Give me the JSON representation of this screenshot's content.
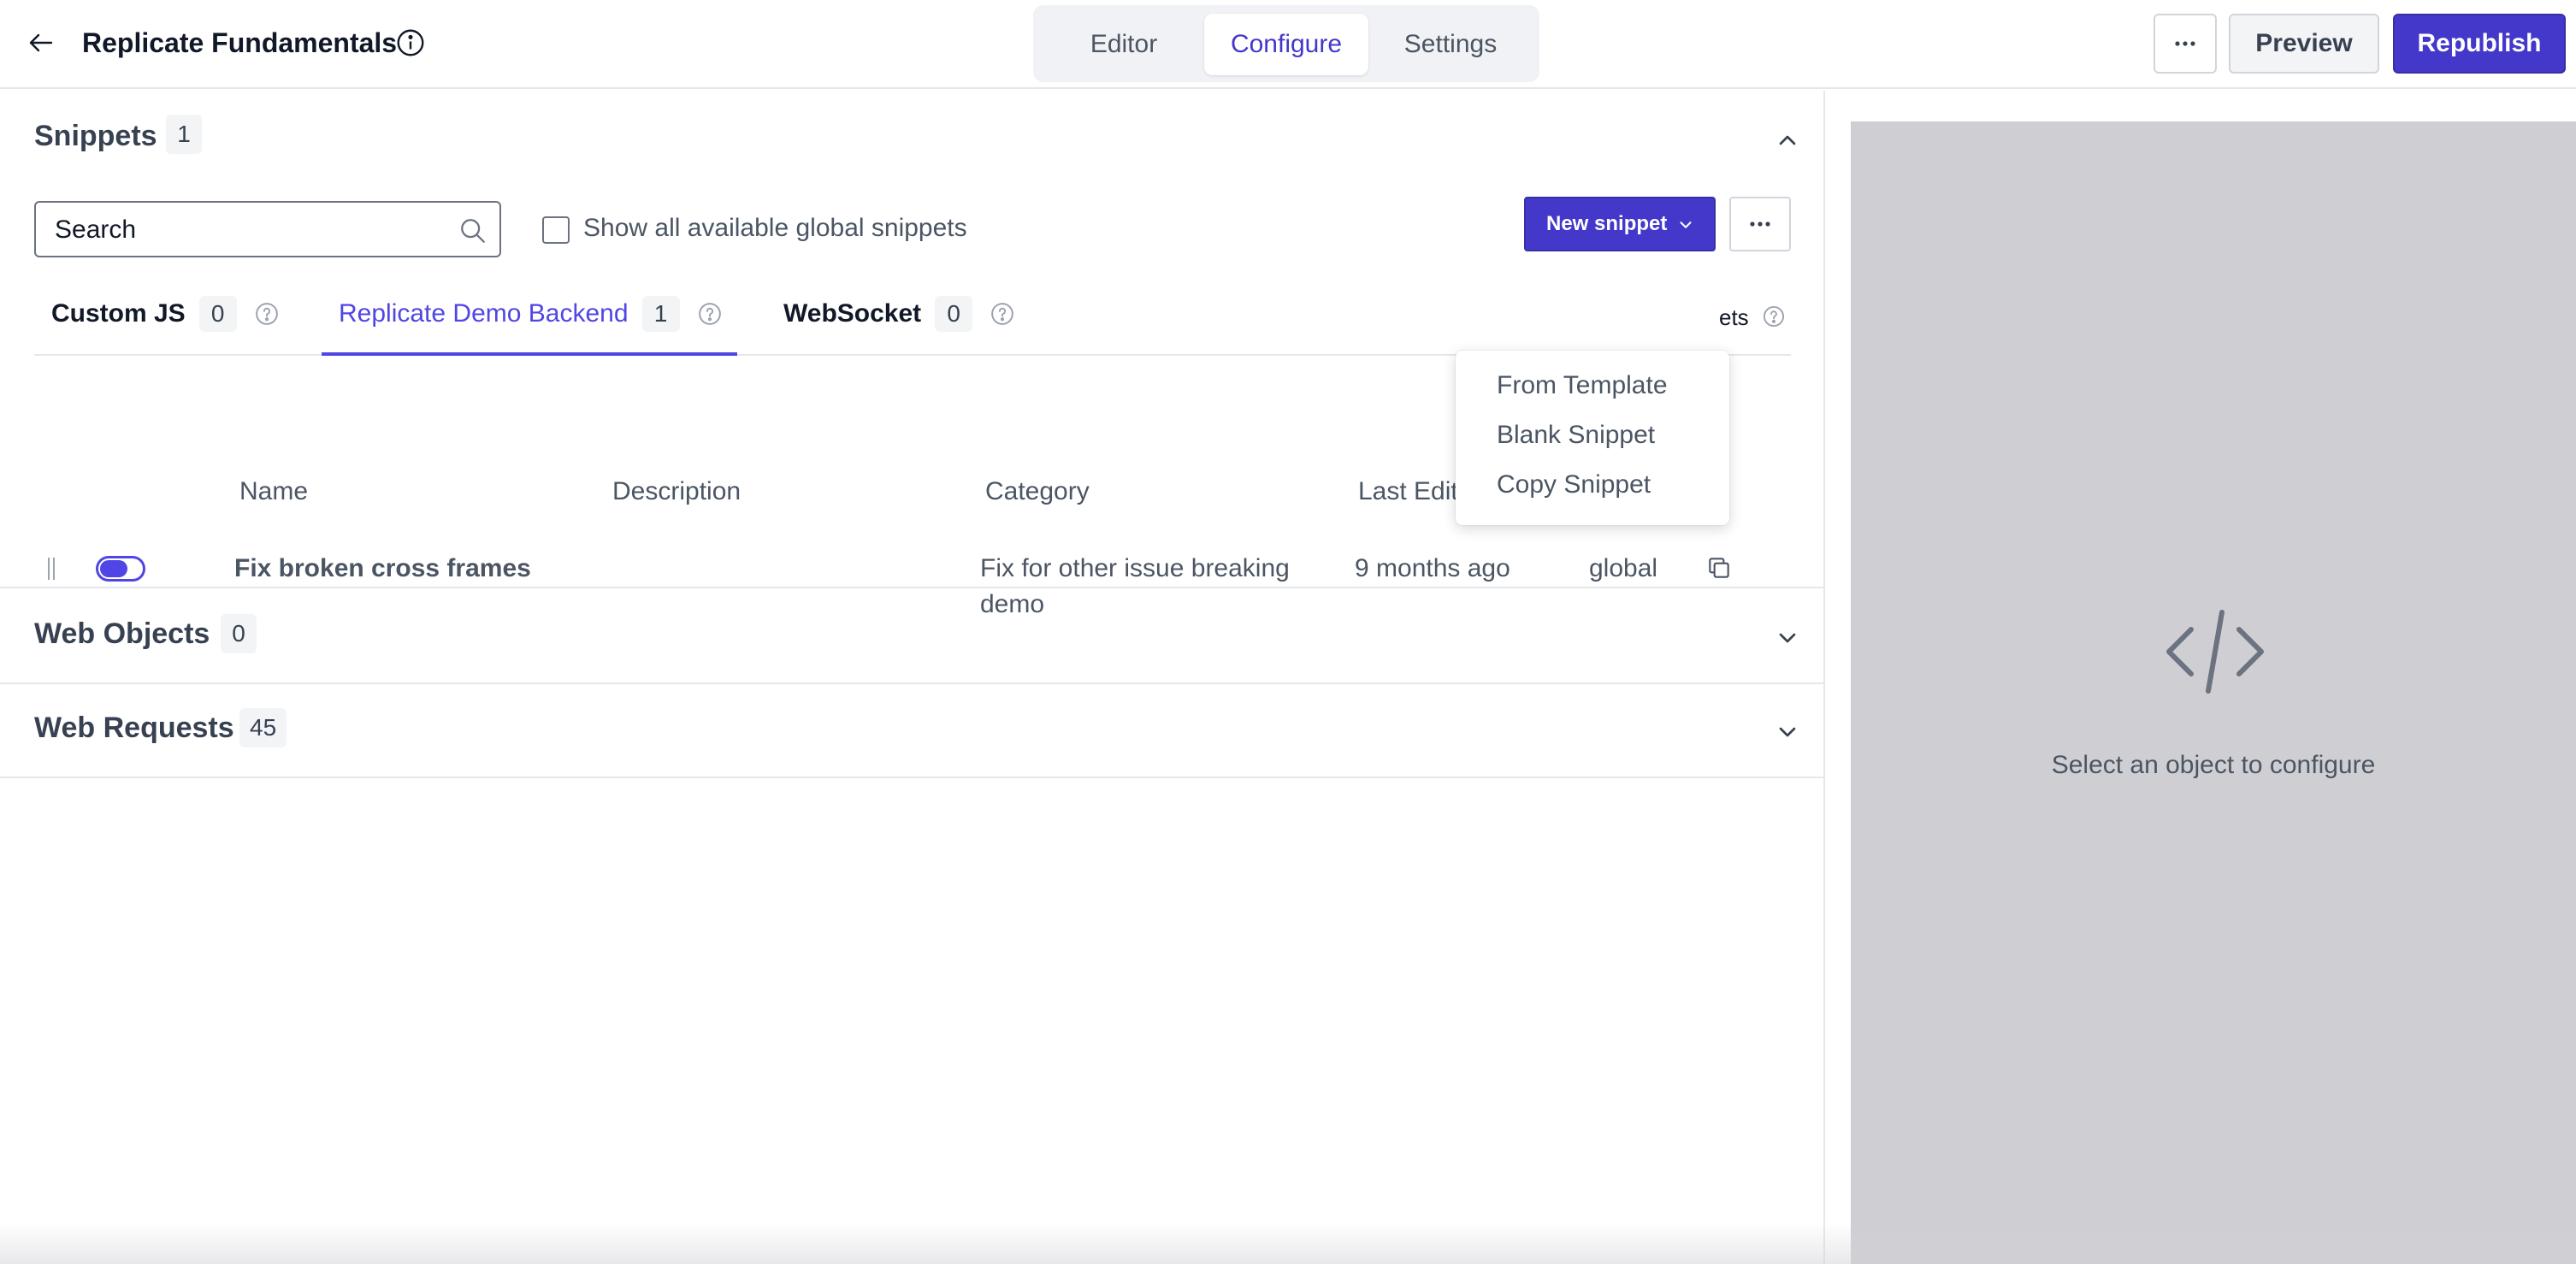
{
  "header": {
    "title": "Replicate Fundamentals",
    "tabs": [
      {
        "label": "Editor"
      },
      {
        "label": "Configure"
      },
      {
        "label": "Settings"
      }
    ],
    "more_label": "···",
    "preview_label": "Preview",
    "republish_label": "Republish"
  },
  "snippets": {
    "title": "Snippets",
    "count": "1",
    "search_placeholder": "Search",
    "checkbox_label": "Show all available global snippets",
    "new_snippet_label": "New snippet",
    "tabs": [
      {
        "label": "Custom JS",
        "count": "0"
      },
      {
        "label": "Replicate Demo Backend",
        "count": "1"
      },
      {
        "label": "WebSocket",
        "count": "0"
      }
    ],
    "partial_tab_text": "ets",
    "columns": [
      "Name",
      "Description",
      "Category",
      "Last Edit"
    ],
    "rows": [
      {
        "name": "Fix broken cross frames",
        "description": "",
        "category_line1": "Fix for other issue breaking",
        "category_line2": "demo",
        "last_edit": "9 months ago",
        "scope": "global",
        "enabled": true
      }
    ],
    "dropdown": [
      "From Template",
      "Blank Snippet",
      "Copy Snippet"
    ]
  },
  "web_objects": {
    "title": "Web Objects",
    "count": "0"
  },
  "web_requests": {
    "title": "Web Requests",
    "count": "45"
  },
  "right_panel": {
    "message": "Select an object to configure"
  },
  "colors": {
    "accent": "#4338ca",
    "panel_bg": "#cfcfd3"
  }
}
